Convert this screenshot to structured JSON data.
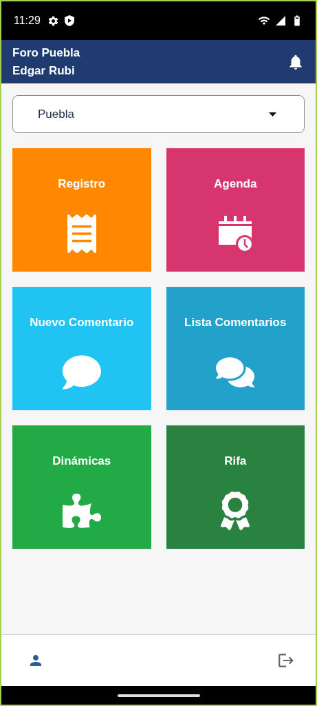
{
  "status_bar": {
    "time": "11:29"
  },
  "header": {
    "title": "Foro Puebla",
    "subtitle": "Edgar Rubi"
  },
  "location_select": {
    "value": "Puebla"
  },
  "tiles": [
    {
      "label": "Registro",
      "color": "#ff8800"
    },
    {
      "label": "Agenda",
      "color": "#d6356d"
    },
    {
      "label": "Nuevo Comentario",
      "color": "#20c3f2"
    },
    {
      "label": "Lista Comentarios",
      "color": "#22a1cb"
    },
    {
      "label": "Dinámicas",
      "color": "#22aa46"
    },
    {
      "label": "Rifa",
      "color": "#2a8240"
    }
  ]
}
